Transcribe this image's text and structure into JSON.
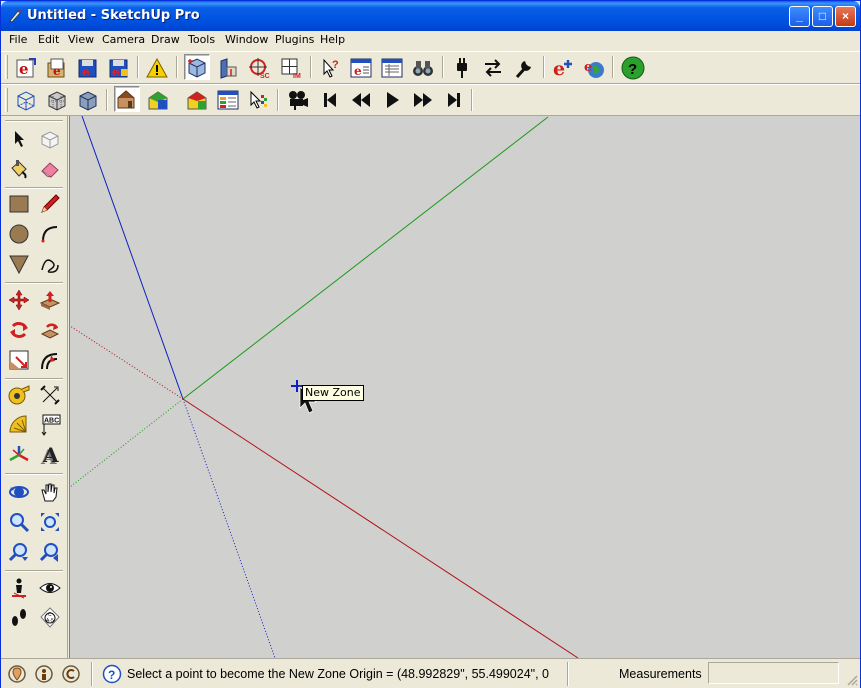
{
  "window": {
    "title": "Untitled - SketchUp Pro",
    "minimize": "_",
    "maximize": "□",
    "close": "×"
  },
  "menu": [
    "File",
    "Edit",
    "View",
    "Camera",
    "Draw",
    "Tools",
    "Window",
    "Plugins",
    "Help"
  ],
  "toolbar_top": [
    "export-web-icon",
    "import-icon",
    "export-icon",
    "save-icon",
    "warning-icon",
    "zone-box-icon",
    "zone-side-icon",
    "target-icon",
    "grid-icon",
    "query-select-icon",
    "run-simulation-icon",
    "output-table-icon",
    "binoculars-icon",
    "plug-icon",
    "swap-arrows-icon",
    "wrench-icon",
    "energyplus-icon",
    "globe-icon",
    "help-icon"
  ],
  "toolbar_second": [
    "xray-icon",
    "back-edges-icon",
    "wireframe-icon",
    "house-icon",
    "house-color-icon",
    "house-yellow-icon",
    "data-table-icon",
    "render-select-icon",
    "movie-camera-icon",
    "first-frame-icon",
    "rewind-icon",
    "play-icon",
    "fast-forward-icon",
    "last-frame-icon"
  ],
  "viewport": {
    "tooltip": "New Zone",
    "axis_colors": {
      "red": "#b01010",
      "green": "#1a9a1a",
      "blue": "#1020c0"
    }
  },
  "status": {
    "message": "Select a point to become the New Zone Origin = (48.992829\", 55.499024\", 0",
    "measurements_label": "Measurements",
    "measurements_value": ""
  }
}
